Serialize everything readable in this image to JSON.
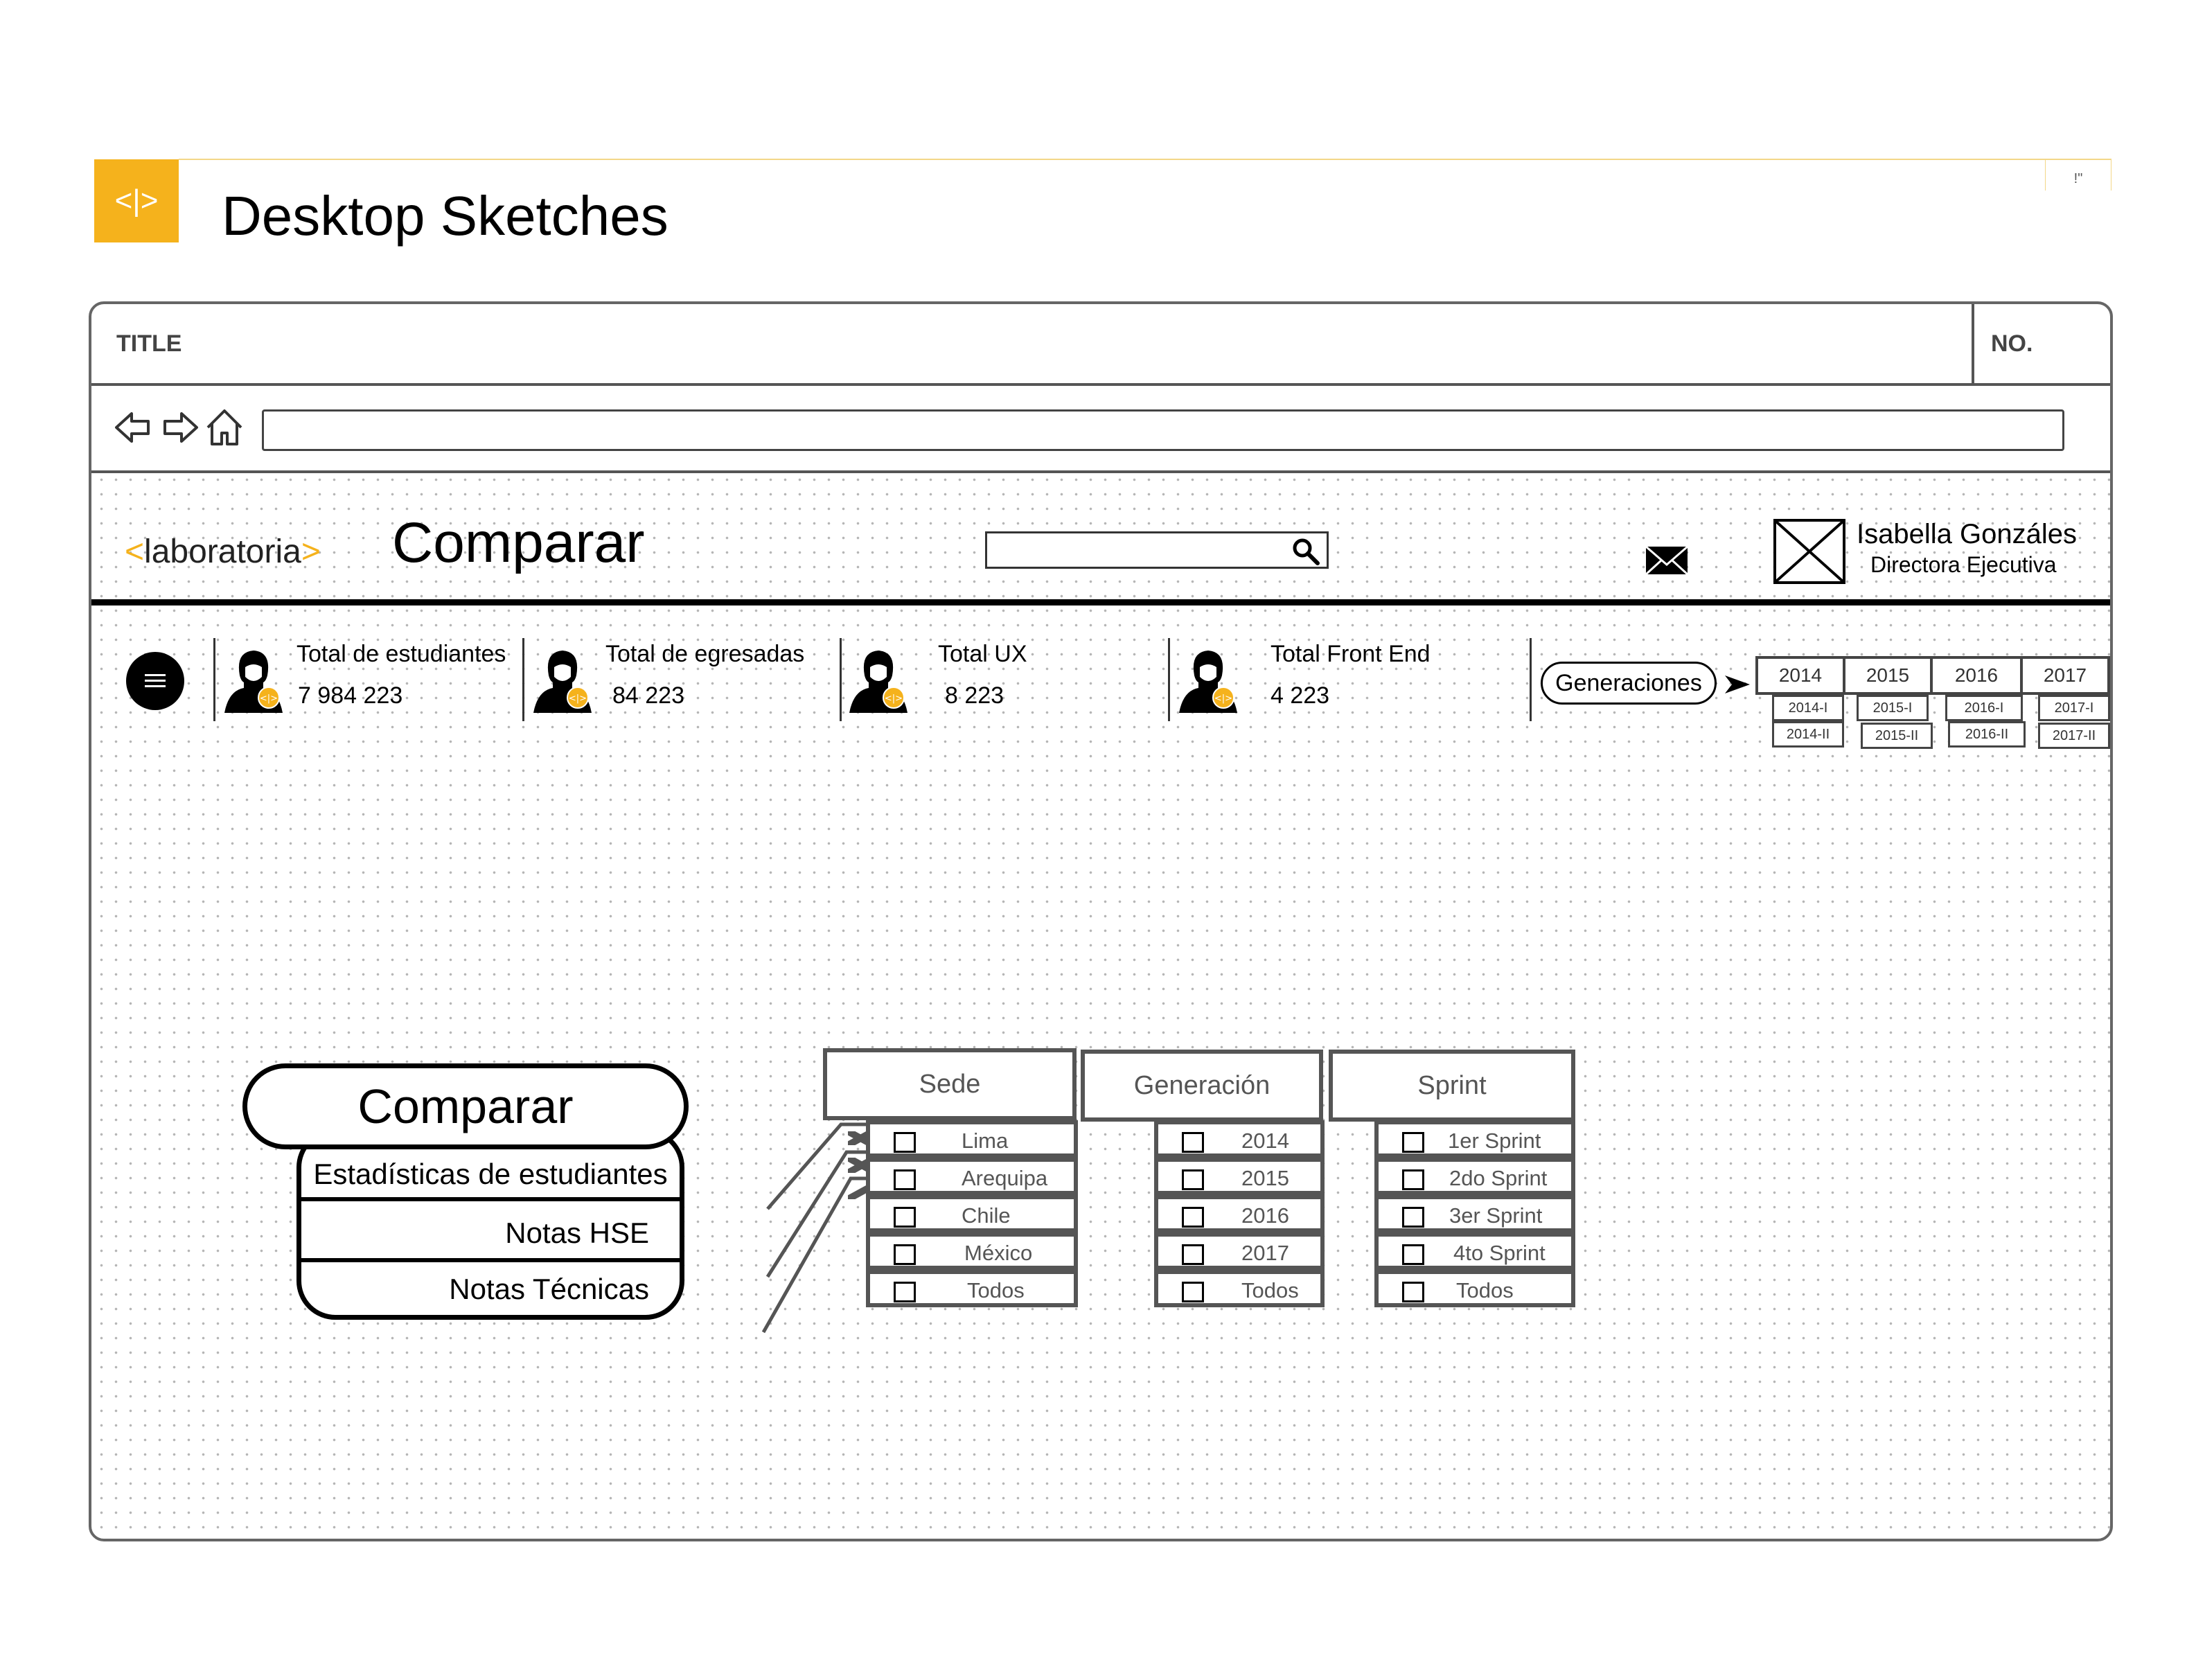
{
  "sheet": {
    "logo": "<|>",
    "title": "Desktop Sketches",
    "mark": "!\""
  },
  "browser": {
    "title_label": "TITLE",
    "no_label": "NO.",
    "url": ""
  },
  "app": {
    "brand": {
      "open": "<",
      "name": "laboratoria",
      "close": ">"
    },
    "page_title": "Comparar",
    "search_placeholder": "",
    "user": {
      "name": "Isabella Gonzáles",
      "role": "Directora Ejecutiva"
    }
  },
  "stats": [
    {
      "label": "Total de estudiantes",
      "value": "7 984 223"
    },
    {
      "label": "Total de egresadas",
      "value": "84 223"
    },
    {
      "label": "Total UX",
      "value": "8 223"
    },
    {
      "label": "Total Front End",
      "value": "4 223"
    }
  ],
  "generations": {
    "label": "Generaciones",
    "years": [
      {
        "year": "2014",
        "subs": [
          "2014-I",
          "2014-II"
        ]
      },
      {
        "year": "2015",
        "subs": [
          "2015-I",
          "2015-II"
        ]
      },
      {
        "year": "2016",
        "subs": [
          "2016-I",
          "2016-II"
        ]
      },
      {
        "year": "2017",
        "subs": [
          "2017-I",
          "2017-II"
        ]
      }
    ]
  },
  "compare": {
    "button": "Comparar",
    "options": [
      "Estadísticas de estudiantes",
      "Notas HSE",
      "Notas Técnicas"
    ]
  },
  "filters": [
    {
      "header": "Sede",
      "items": [
        "Lima",
        "Arequipa",
        "Chile",
        "México",
        "Todos"
      ]
    },
    {
      "header": "Generación",
      "items": [
        "2014",
        "2015",
        "2016",
        "2017",
        "Todos"
      ]
    },
    {
      "header": "Sprint",
      "items": [
        "1er Sprint",
        "2do Sprint",
        "3er Sprint",
        "4to Sprint",
        "Todos"
      ]
    }
  ],
  "colors": {
    "accent": "#f5b21c",
    "ink": "#000000",
    "frame_gray": "#555555"
  },
  "icons": [
    "back-arrow-icon",
    "forward-arrow-icon",
    "home-icon",
    "search-icon",
    "mail-icon",
    "image-placeholder-icon",
    "hamburger-menu-icon",
    "student-avatar-icon",
    "arrow-right-icon"
  ]
}
